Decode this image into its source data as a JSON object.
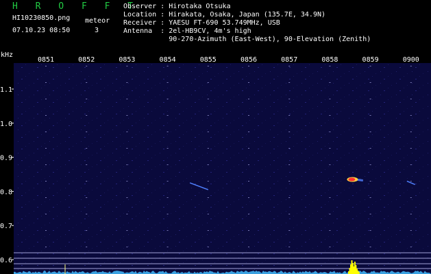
{
  "header": {
    "brand": "H R O F F T",
    "filename": "HI10230850.png",
    "timestamp": "07.10.23 08:50",
    "meteor_label": "meteor",
    "meteor_count": "3",
    "info_lines": [
      "Observer : Hirotaka Otsuka",
      "Location : Hirakata, Osaka, Japan (135.7E, 34.9N)",
      "Receiver : YAESU FT-690 53.749MHz, USB",
      "Antenna  : 2el-HB9CV, 4m's high",
      "           90-270-Azimuth (East-West), 90-Elevation (Zenith)"
    ]
  },
  "colors": {
    "background": "#000000",
    "plot_background": "#0a0a3c",
    "text": "#ffffff",
    "brand": "#22cc44",
    "tick": "#7878b4",
    "baseline": "#c8c8ff",
    "noise": "#3aa0e0",
    "echo_core": "#ff3030",
    "echo_mid": "#ffd040",
    "echo_edge": "#5080ff",
    "burst": "#ffff00"
  },
  "chart_data": {
    "type": "heatmap",
    "title": "",
    "ylabel": "kHz",
    "xlabel": "",
    "x_tick_labels": [
      "0851",
      "0852",
      "0853",
      "0854",
      "0855",
      "0856",
      "0857",
      "0858",
      "0859",
      "0900"
    ],
    "y_tick_labels": [
      "1.1",
      "1.0",
      "0.9",
      "0.8",
      "0.7",
      "0.6"
    ],
    "y_tick_values": [
      1.1,
      1.0,
      0.9,
      0.8,
      0.7,
      0.6
    ],
    "x_range_minutes": [
      0,
      10
    ],
    "y_range_khz": [
      0.58,
      1.15
    ],
    "meteor_echoes": [
      {
        "t_start": 3.55,
        "t_end": 4.0,
        "f_start": 0.825,
        "f_end": 0.805,
        "intensity": "low"
      },
      {
        "t_start": 7.5,
        "t_end": 7.75,
        "f_start": 0.838,
        "f_end": 0.832,
        "intensity": "high"
      },
      {
        "t_start": 8.9,
        "t_end": 9.1,
        "f_start": 0.83,
        "f_end": 0.82,
        "intensity": "low"
      }
    ],
    "spectrum_burst": {
      "t_start": 7.5,
      "t_end": 7.7
    }
  }
}
